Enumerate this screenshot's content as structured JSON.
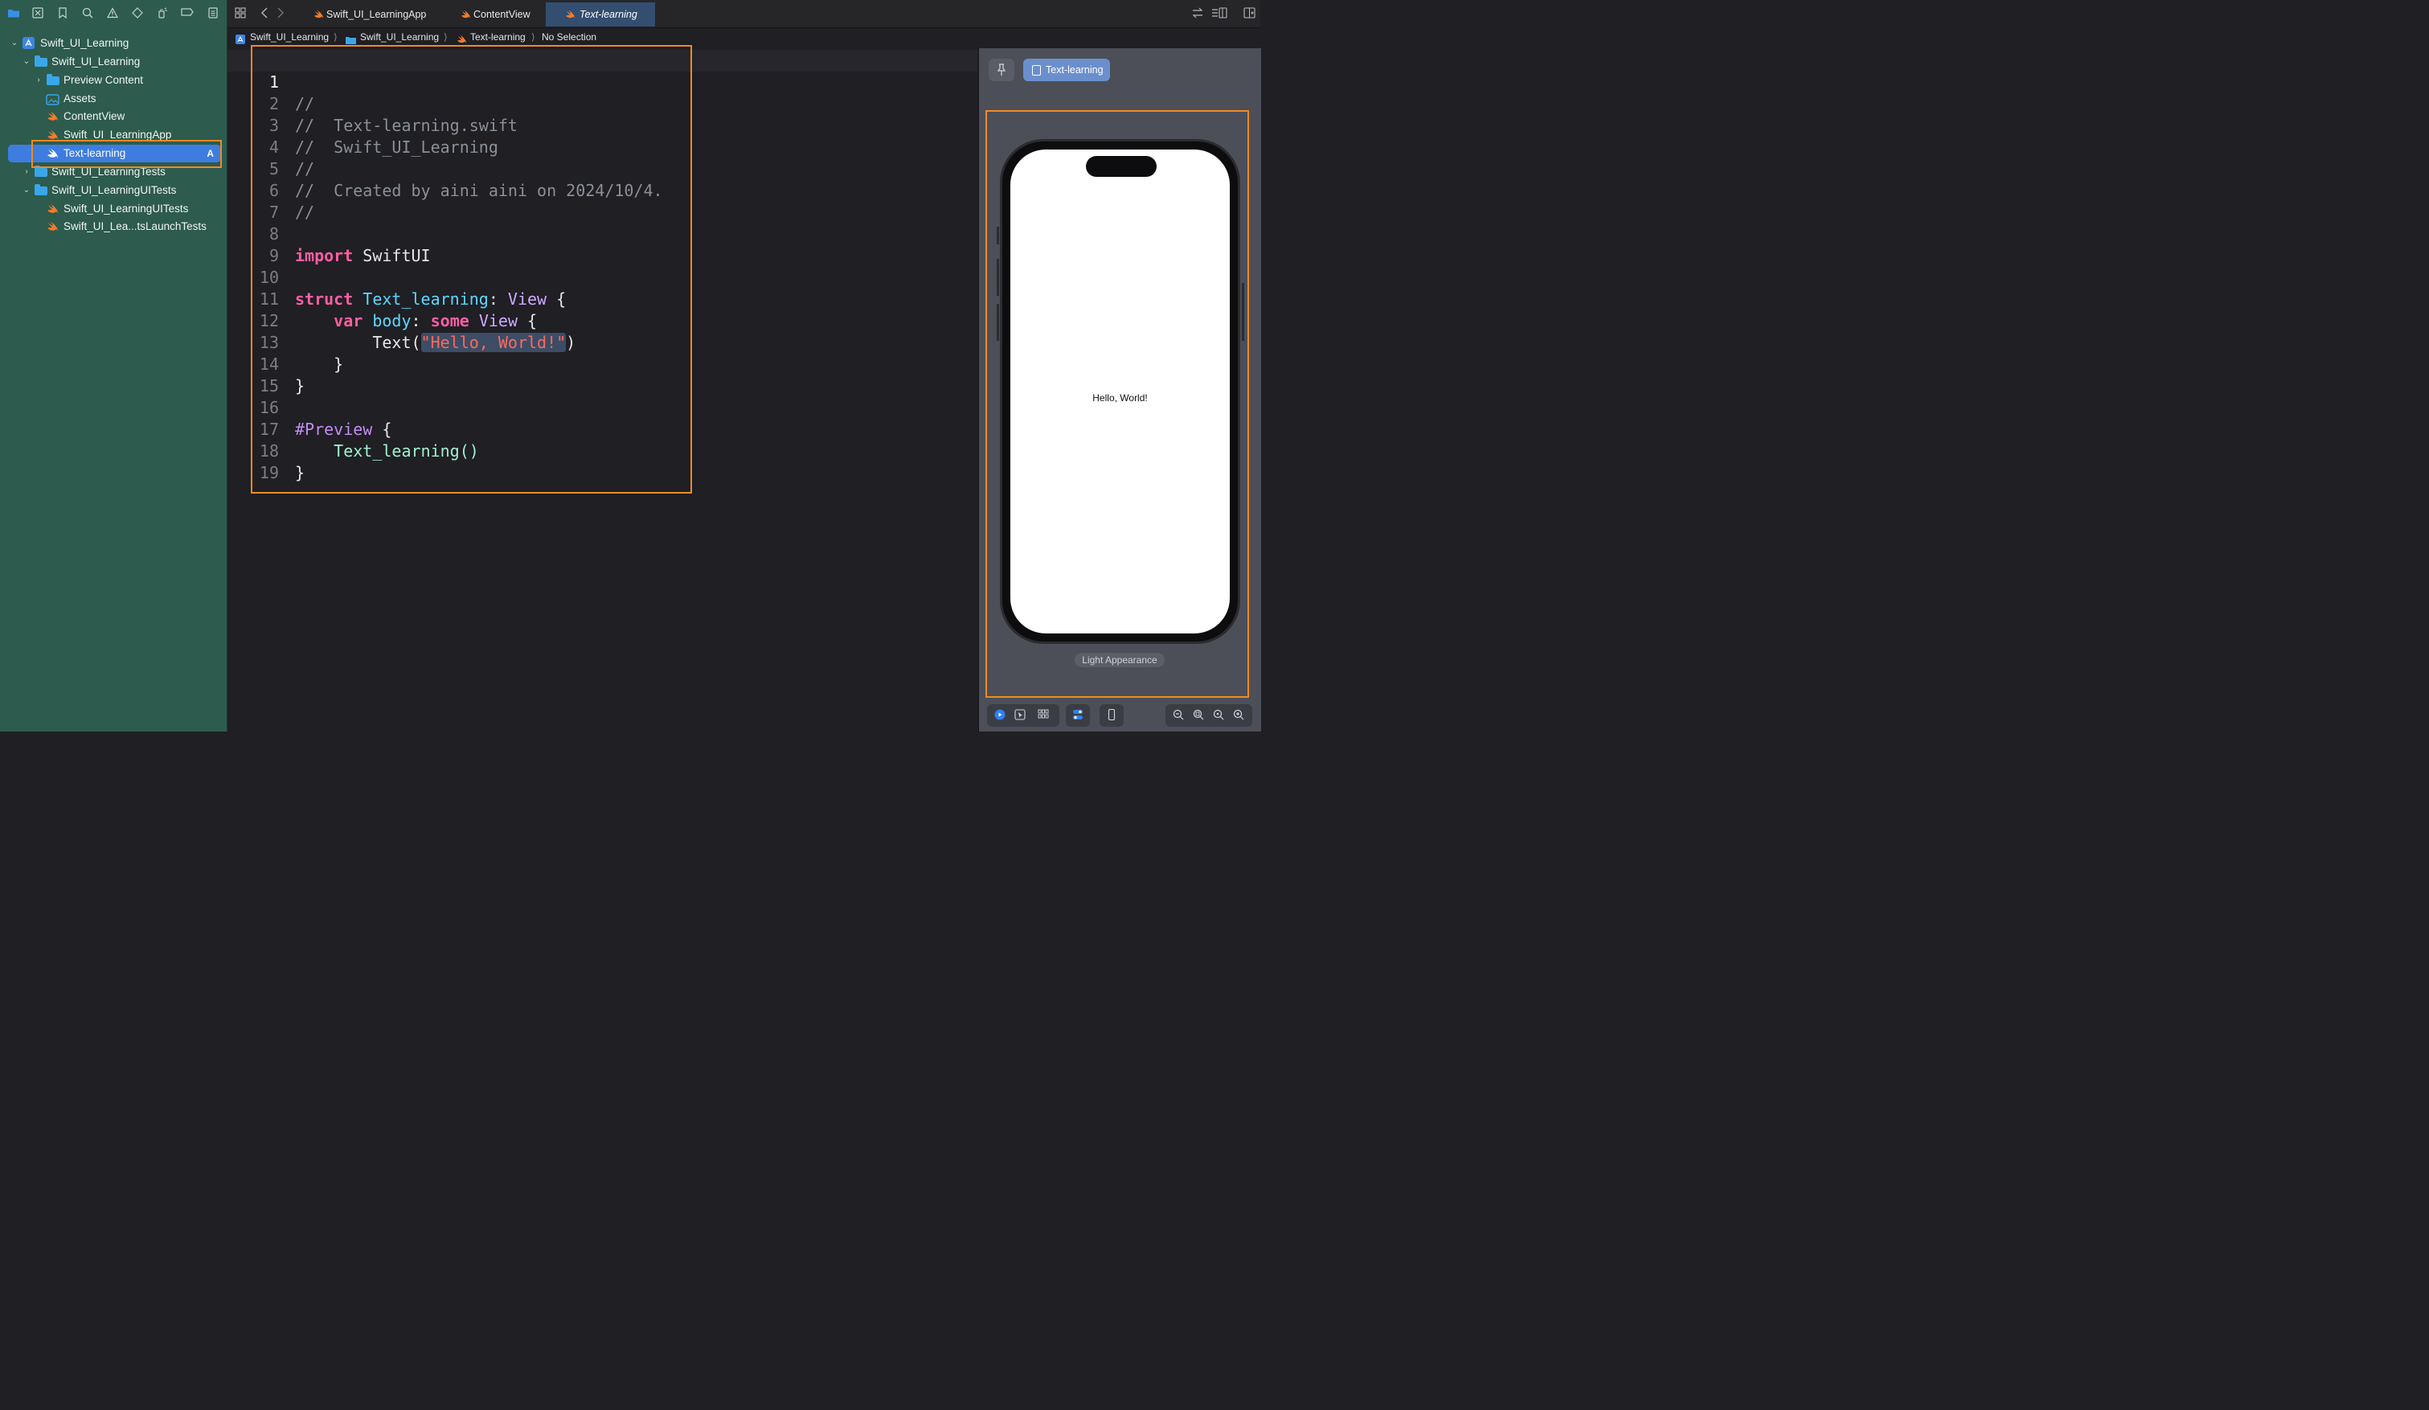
{
  "sidebar": {
    "toolbar_icons": [
      "folder-icon",
      "source-control-icon",
      "bookmark-icon",
      "search-icon",
      "issue-warning-icon",
      "test-diamond-icon",
      "debug-spray-icon",
      "breakpoint-icon",
      "report-icon"
    ],
    "tree": [
      {
        "label": "Swift_UI_Learning",
        "kind": "project",
        "expanded": true
      },
      {
        "label": "Swift_UI_Learning",
        "kind": "folder",
        "expanded": true
      },
      {
        "label": "Preview Content",
        "kind": "folder",
        "expanded": false
      },
      {
        "label": "Assets",
        "kind": "assets"
      },
      {
        "label": "ContentView",
        "kind": "swift"
      },
      {
        "label": "Swift_UI_LearningApp",
        "kind": "swift"
      },
      {
        "label": "Text-learning",
        "kind": "swift",
        "selected": true,
        "badge": "A"
      },
      {
        "label": "Swift_UI_LearningTests",
        "kind": "folder",
        "expanded": false
      },
      {
        "label": "Swift_UI_LearningUITests",
        "kind": "folder",
        "expanded": true
      },
      {
        "label": "Swift_UI_LearningUITests",
        "kind": "swift"
      },
      {
        "label": "Swift_UI_Lea...tsLaunchTests",
        "kind": "swift"
      }
    ]
  },
  "tabs": [
    {
      "label": "Swift_UI_LearningApp",
      "active": false
    },
    {
      "label": "ContentView",
      "active": false
    },
    {
      "label": "Text-learning",
      "active": true
    }
  ],
  "breadcrumb": [
    "Swift_UI_Learning",
    "Swift_UI_Learning",
    "Text-learning",
    "No Selection"
  ],
  "code": {
    "current_line": 1,
    "line_numbers": [
      "1",
      "2",
      "3",
      "4",
      "5",
      "6",
      "7",
      "8",
      "9",
      "10",
      "11",
      "12",
      "13",
      "14",
      "15",
      "16",
      "17",
      "18",
      "19"
    ],
    "lines": {
      "l1": "//",
      "l2": "//  Text-learning.swift",
      "l3": "//  Swift_UI_Learning",
      "l4": "//",
      "l5": "//  Created by aini aini on 2024/10/4.",
      "l6": "//",
      "l8_kw": "import",
      "l8_rest": " SwiftUI",
      "l10_kw": "struct",
      "l10_name": " Text_learning",
      "l10_colon": ": ",
      "l10_type": "View",
      "l10_brace": " {",
      "l11_indent": "    ",
      "l11_kw": "var",
      "l11_name": " body",
      "l11_colon": ": ",
      "l11_kw2": "some",
      "l11_type": " View",
      "l11_brace": " {",
      "l12_indent": "        ",
      "l12_fn": "Text(",
      "l12_str": "\"Hello, World!\"",
      "l12_close": ")",
      "l13": "    }",
      "l14": "}",
      "l16_macro": "#Preview",
      "l16_brace": " {",
      "l17_indent": "    ",
      "l17_fn": "Text_learning()",
      "l18": "}"
    }
  },
  "canvas": {
    "preview_chip": "Text-learning",
    "screen_text": "Hello, World!",
    "appearance_label": "Light Appearance"
  },
  "colors": {
    "sidebar_bg": "#2d5b4d",
    "selection": "#3e7de0",
    "highlight_border": "#f08a24",
    "keyword": "#fc5fa3",
    "string": "#fc6a5d",
    "type": "#d0a8ff"
  }
}
